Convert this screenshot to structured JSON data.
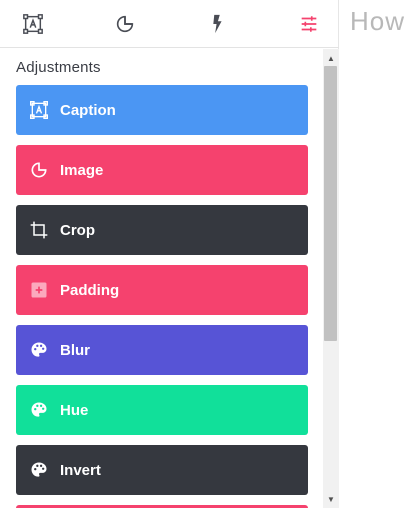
{
  "toolbar": {
    "tabs": [
      {
        "icon": "caption-frame-icon",
        "active": false
      },
      {
        "icon": "pie-icon",
        "active": false
      },
      {
        "icon": "bolt-icon",
        "active": false
      },
      {
        "icon": "sliders-icon",
        "active": true
      }
    ],
    "active_color": "#f5426e",
    "inactive_color": "#4a4d55"
  },
  "sidebar": {
    "section_title": "Adjustments",
    "items": [
      {
        "label": "Caption",
        "icon": "caption-icon",
        "color": "#4b96f3"
      },
      {
        "label": "Image",
        "icon": "image-icon",
        "color": "#f5426e"
      },
      {
        "label": "Crop",
        "icon": "crop-icon",
        "color": "#35383f"
      },
      {
        "label": "Padding",
        "icon": "padding-icon",
        "color": "#f5426e"
      },
      {
        "label": "Blur",
        "icon": "palette-icon",
        "color": "#5754d6"
      },
      {
        "label": "Hue",
        "icon": "palette-icon",
        "color": "#11e09a"
      },
      {
        "label": "Invert",
        "icon": "palette-icon",
        "color": "#35383f"
      }
    ]
  },
  "main": {
    "title": "How"
  }
}
